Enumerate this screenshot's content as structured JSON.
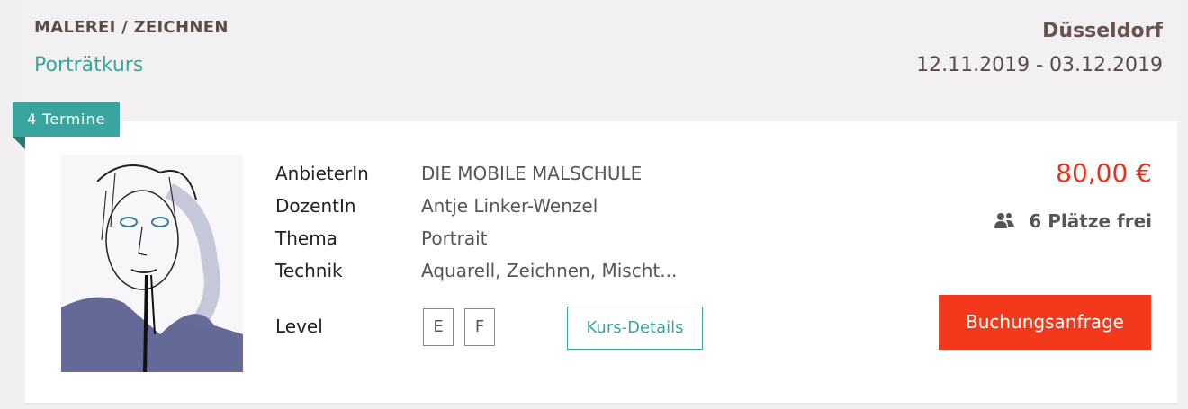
{
  "header": {
    "category": "MALEREI / ZEICHNEN",
    "title": "Porträtkurs",
    "city": "Düsseldorf",
    "date_range": "12.11.2019 - 03.12.2019"
  },
  "termine_badge": "4 Termine",
  "info": {
    "labels": [
      "AnbieterIn",
      "DozentIn",
      "Thema",
      "Technik"
    ],
    "values": [
      "DIE MOBILE MALSCHULE",
      "Antje Linker-Wenzel",
      "Portrait",
      "Aquarell, Zeichnen, Mischt..."
    ],
    "level_label": "Level",
    "levels": [
      "E",
      "F"
    ]
  },
  "buttons": {
    "details": "Kurs-Details",
    "booking": "Buchungsanfrage"
  },
  "price": "80,00 €",
  "places": "6 Plätze frei",
  "colors": {
    "accent": "#3aa59e",
    "price": "#e8331c",
    "booking": "#f2391b"
  },
  "icons": {
    "places": "users-icon"
  }
}
